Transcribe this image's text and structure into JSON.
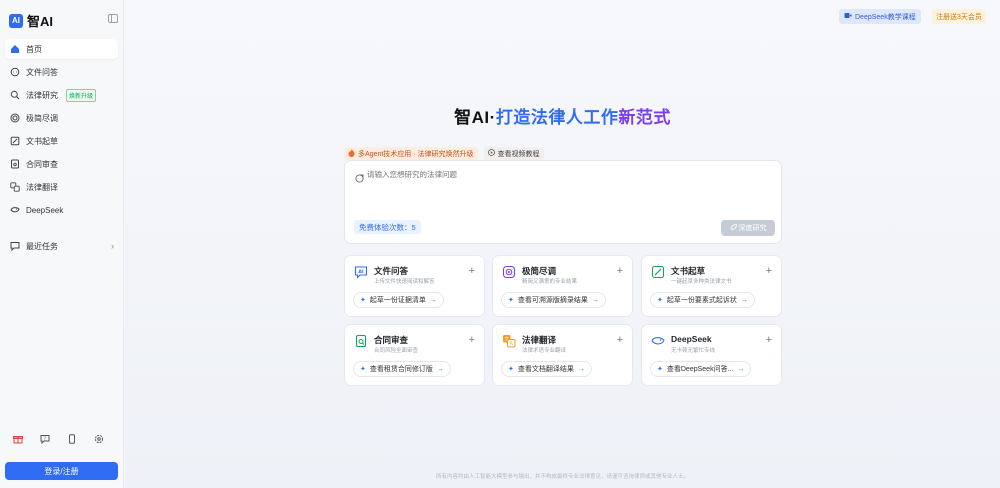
{
  "app": {
    "name": "智AI",
    "logo_mark": "AI"
  },
  "sidebar": {
    "items": [
      {
        "label": "首页",
        "icon": "home-icon",
        "active": true
      },
      {
        "label": "文件问答",
        "icon": "chat-icon"
      },
      {
        "label": "法律研究",
        "icon": "search-icon",
        "badge": "焕新升级"
      },
      {
        "label": "极简尽调",
        "icon": "target-icon"
      },
      {
        "label": "文书起草",
        "icon": "edit-icon"
      },
      {
        "label": "合同审查",
        "icon": "contract-icon"
      },
      {
        "label": "法律翻译",
        "icon": "translate-icon"
      },
      {
        "label": "DeepSeek",
        "icon": "whale-icon"
      }
    ],
    "recent_label": "最近任务",
    "login_label": "登录/注册"
  },
  "header": {
    "course_label": "DeepSeek教学课程",
    "member_label": "注册送3天会员"
  },
  "hero": {
    "title_a": "智AI·",
    "title_b": "打造法律人工作",
    "title_c": "新范式"
  },
  "tags": {
    "hot": "多Agent技术应用 · 法律研究焕然升级",
    "video": "查看视频教程"
  },
  "input": {
    "placeholder": "请输入您想研究的法律问题",
    "quota": "免费体验次数：5",
    "deep_research": "深度研究"
  },
  "cards": [
    {
      "title": "文件问答",
      "subtitle": "上传文件快速阅读和解答",
      "action": "起草一份证据清单",
      "icon": "ai-chat-icon"
    },
    {
      "title": "极简尽调",
      "subtitle": "精简又满意的专业结果",
      "action": "查看可溯源版摘录结果",
      "icon": "target-icon"
    },
    {
      "title": "文书起草",
      "subtitle": "一键起草多种类法律文书",
      "action": "起草一份要素式起诉状",
      "icon": "edit-icon"
    },
    {
      "title": "合同审查",
      "subtitle": "合同风险全面审查",
      "action": "查看租赁合同修订版",
      "icon": "contract-icon"
    },
    {
      "title": "法律翻译",
      "subtitle": "法律术语专业翻译",
      "action": "查看文档翻译结果",
      "icon": "translate-icon"
    },
    {
      "title": "DeepSeek",
      "subtitle": "无卡顿无繁忙专线",
      "action": "查看DeepSeek问答...",
      "icon": "whale-icon"
    }
  ],
  "footer": "所有内容均由人工智能大模型参与输出，并不构成最终专业法律意见，请谨可咨询律师或其他专业人士。",
  "colors": {
    "accent": "#2f6cf3",
    "purple": "#7a3df0",
    "member": "#c77a12"
  }
}
